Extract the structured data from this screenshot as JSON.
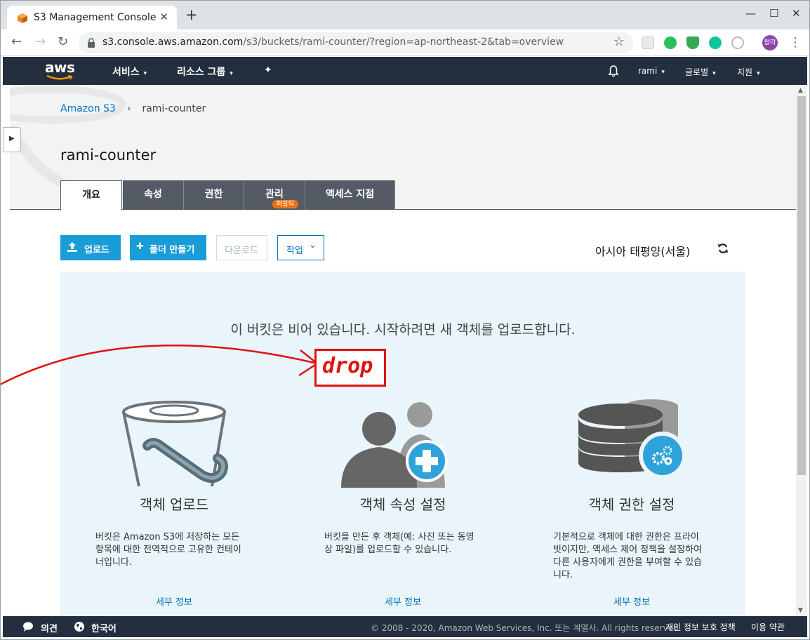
{
  "browser": {
    "tab_title": "S3 Management Console",
    "close_glyph": "✕",
    "new_tab_glyph": "+",
    "win_min": "—",
    "win_max": "☐",
    "win_close": "✕",
    "url_host": "s3.console.aws.amazon.com",
    "url_path": "/s3/buckets/rami-counter/?region=ap-northeast-2&tab=overview",
    "back_glyph": "←",
    "forward_glyph": "→",
    "reload_glyph": "↻",
    "star_glyph": "☆",
    "profile_label": "람라",
    "menu_glyph": "⋮"
  },
  "aws_nav": {
    "logo": "aws",
    "services": "서비스",
    "resource_groups": "리소스 그룹",
    "user": "rami",
    "region": "글로벌",
    "support": "지원",
    "caret": "▾",
    "pin_glyph": "✦"
  },
  "breadcrumb": {
    "root": "Amazon S3",
    "sep": "›",
    "current": "rami-counter"
  },
  "bucket_title": "rami-counter",
  "tabs": [
    {
      "label": "개요",
      "active": true
    },
    {
      "label": "속성"
    },
    {
      "label": "권한"
    },
    {
      "label": "관리",
      "badge": "퍼블릭"
    },
    {
      "label": "액세스 지점"
    }
  ],
  "actions": {
    "upload": "업로드",
    "create_folder": "폴더 만들기",
    "download": "다운로드",
    "actions": "작업",
    "plus_glyph": "✚",
    "chevron": "⌄"
  },
  "region_label": "아시아 태평양(서울)",
  "empty_message": "이 버킷은 비어 있습니다. 시작하려면 새 객체를 업로드합니다.",
  "cards": [
    {
      "title": "객체 업로드",
      "desc_lines": [
        "버킷은 Amazon S3에 저장하는 모든",
        "항목에 대한 전역적으로 고유한 컨테이",
        "너입니다."
      ],
      "link": "세부 정보"
    },
    {
      "title": "객체 속성 설정",
      "desc_lines": [
        "버킷을 만든 후 객체(예: 사진 또는 동영",
        "상 파일)를 업로드할 수 있습니다."
      ],
      "link": "세부 정보"
    },
    {
      "title": "객체 권한 설정",
      "desc_lines": [
        "기본적으로 객체에 대한 권한은 프라이",
        "빗이지만, 액세스 제어 정책을 설정하여",
        "다른 사용자에게 권한을 부여할 수 있습",
        "니다."
      ],
      "link": "세부 정보"
    }
  ],
  "annotation": {
    "drop_label": "drop",
    "color": "#e0110f"
  },
  "footer": {
    "feedback": "의견",
    "language": "한국어",
    "copyright": "© 2008 - 2020, Amazon Web Services, Inc. 또는 계열사. All rights reserved.",
    "privacy": "개인 정보 보호 정책",
    "terms": "이용 약관"
  },
  "scrollbar": {
    "up": "▲",
    "down": "▼"
  },
  "side_toggle_glyph": "▶",
  "colors": {
    "aws_nav_bg": "#232f3e",
    "primary_button": "#1a9cd8",
    "link": "#0073bb",
    "panel_bg": "#e9f4fb",
    "badge": "#ec7211"
  }
}
